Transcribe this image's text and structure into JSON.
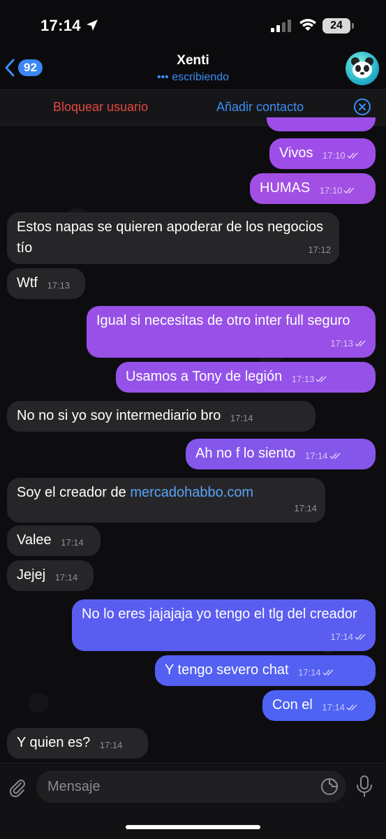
{
  "status": {
    "time": "17:14",
    "battery": "24"
  },
  "header": {
    "back_count": "92",
    "title": "Xenti",
    "subtitle": "••• escribiendo"
  },
  "action_bar": {
    "block": "Bloquear usuario",
    "add": "Añadir contacto"
  },
  "messages": [
    {
      "dir": "out",
      "text": "Vivos",
      "time": "17:10",
      "color": "#9e4ee8"
    },
    {
      "dir": "out",
      "text": "HUMAS",
      "time": "17:10",
      "color": "#a24fe3"
    },
    {
      "dir": "in",
      "text": "Estos napas se quieren apoderar de los negocios tío",
      "time": "17:12"
    },
    {
      "dir": "in",
      "text": "Wtf",
      "time": "17:13"
    },
    {
      "dir": "out",
      "text": "Igual si necesitas de otro inter full seguro",
      "time": "17:13",
      "color": "#9850e6"
    },
    {
      "dir": "out",
      "text": "Usamos a Tony de legión",
      "time": "17:13",
      "color": "#9452e8"
    },
    {
      "dir": "in",
      "text": "No no si yo soy intermediario bro",
      "time": "17:14"
    },
    {
      "dir": "out",
      "text": "Ah no f lo siento",
      "time": "17:14",
      "color": "#8556ea"
    },
    {
      "dir": "in",
      "text": "Soy el creador de",
      "link": "mercadohabbo.com",
      "time": "17:14"
    },
    {
      "dir": "in",
      "text": "Valee",
      "time": "17:14"
    },
    {
      "dir": "in",
      "text": "Jejej",
      "time": "17:14"
    },
    {
      "dir": "out",
      "text": "No lo eres jajajaja yo tengo el tlg del creador",
      "time": "17:14",
      "color": "#5a5df0"
    },
    {
      "dir": "out",
      "text": "Y tengo severo chat",
      "time": "17:14",
      "color": "#5360f2"
    },
    {
      "dir": "out",
      "text": "Con el",
      "time": "17:14",
      "color": "#4e62f3"
    },
    {
      "dir": "in",
      "text": "Y quien es?",
      "time": "17:14"
    }
  ],
  "composer": {
    "placeholder": "Mensaje"
  }
}
